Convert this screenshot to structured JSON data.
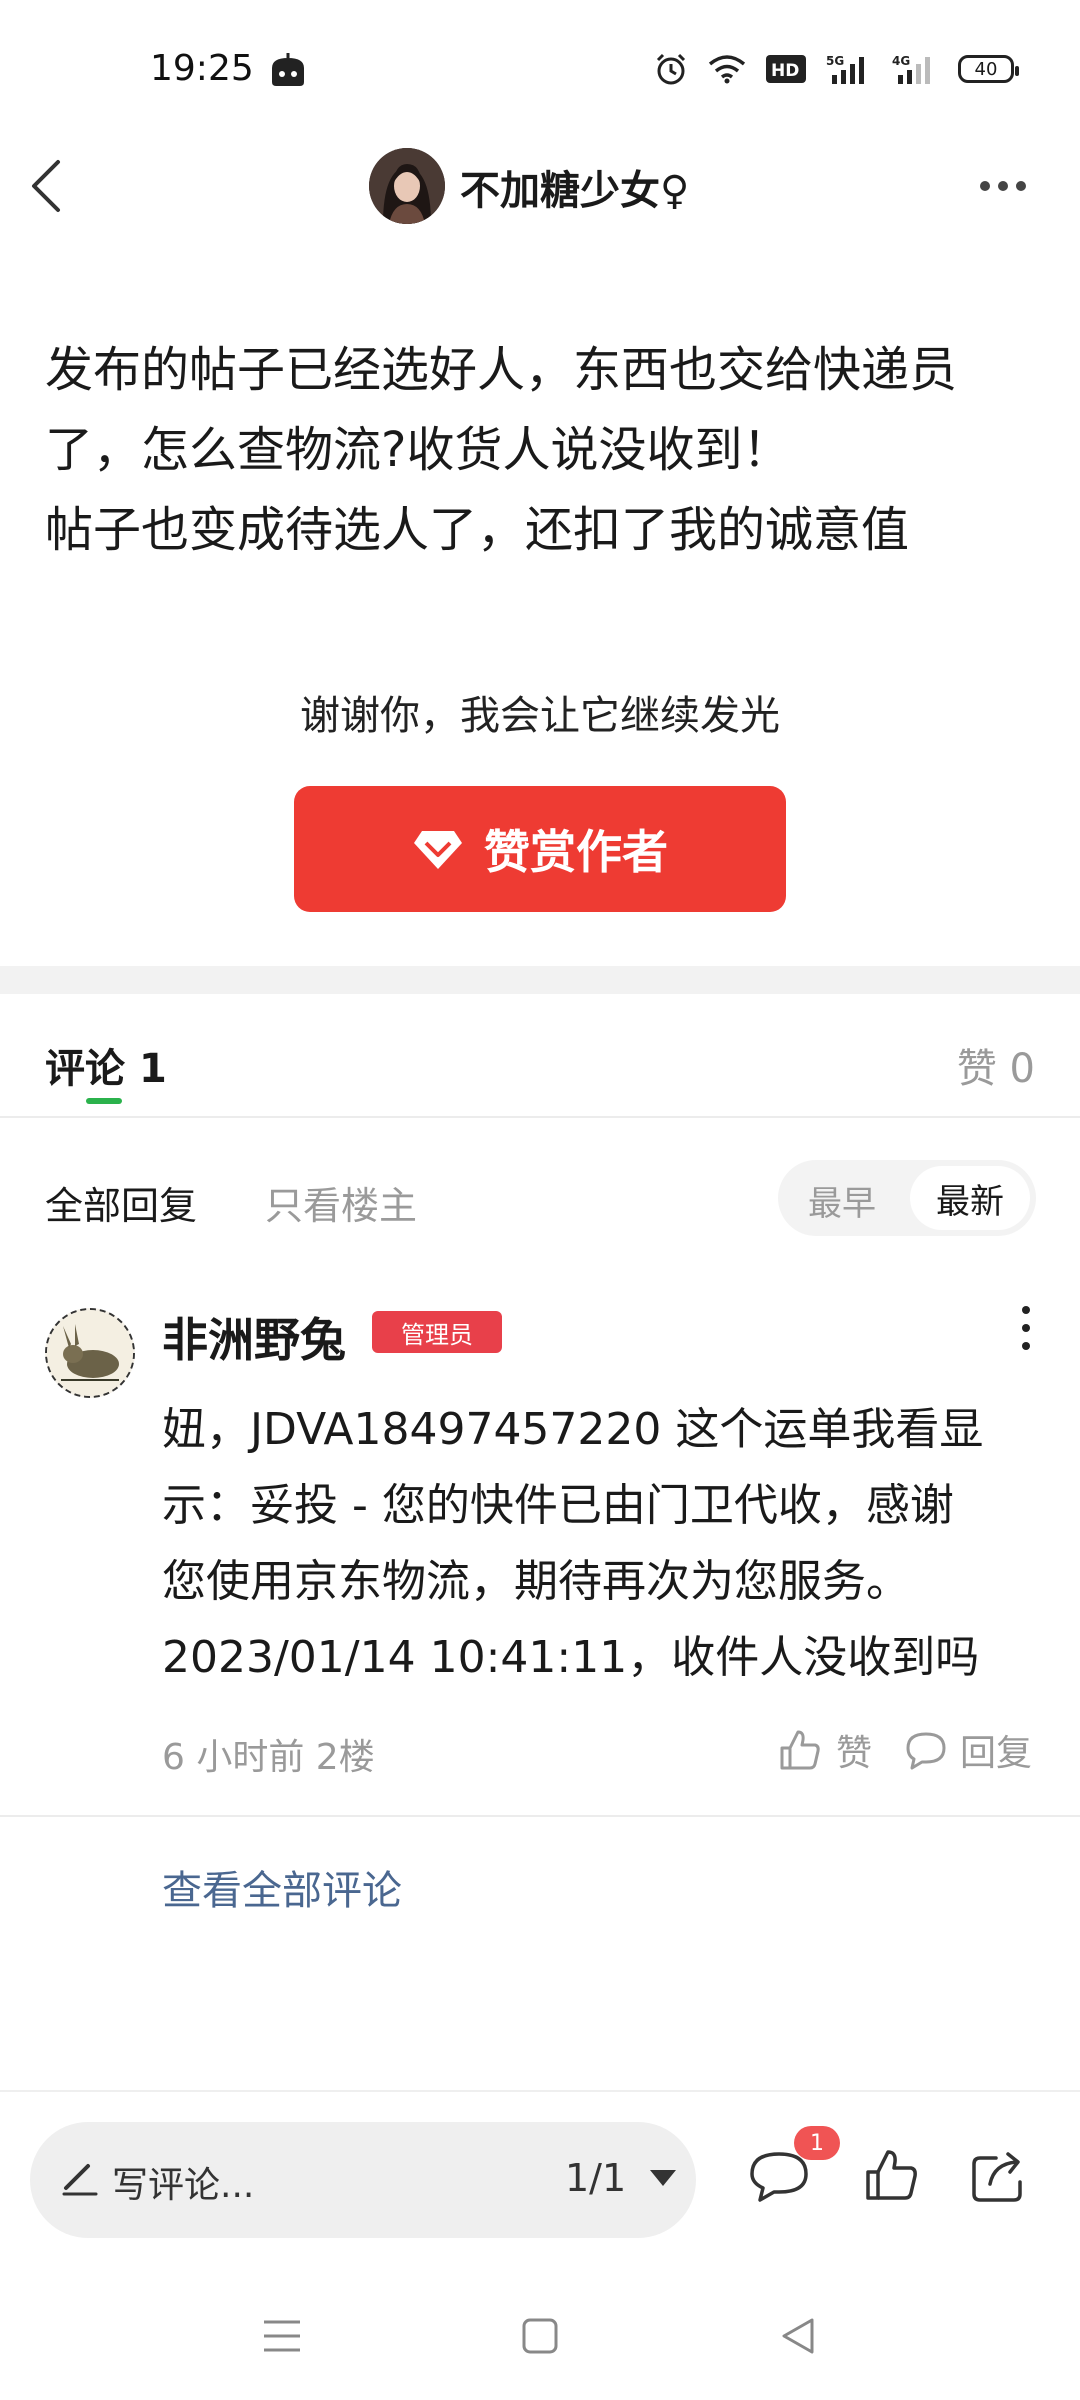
{
  "status_bar": {
    "time": "19:25",
    "battery": "40",
    "icons": [
      "alarm-icon",
      "wifi-icon",
      "hd-icon",
      "5g-signal-icon",
      "4g-signal-icon",
      "battery-icon"
    ]
  },
  "header": {
    "author_name": "不加糖少女♀",
    "back_icon": "chevron-left-icon",
    "more_icon": "more-horizontal-icon"
  },
  "post": {
    "lines": [
      "发布的帖子已经选好人，东西也交给快递员",
      "了，怎么查物流?收货人说没收到！",
      "帖子也变成待选人了，还扣了我的诚意值"
    ],
    "thanks_text": "谢谢你，我会让它继续发光",
    "reward_label": "赞赏作者"
  },
  "tabs": {
    "comments_label": "评论",
    "comments_count": "1",
    "likes_label": "赞 0"
  },
  "filters": {
    "all_replies": "全部回复",
    "owner_only": "只看楼主",
    "sort_earliest": "最早",
    "sort_newest": "最新"
  },
  "comment": {
    "username": "非洲野兔",
    "badge": "管理员",
    "lines": [
      "妞，JDVA18497457220 这个运单我看显",
      "示：妥投 - 您的快件已由门卫代收，感谢",
      "您使用京东物流，期待再次为您服务。",
      "2023/01/14 10:41:11，收件人没收到吗"
    ],
    "meta": "6 小时前  2楼",
    "like_label": "赞",
    "reply_label": "回复"
  },
  "view_all_label": "查看全部评论",
  "bottom_bar": {
    "write_placeholder": "写评论...",
    "page": "1/1",
    "comment_badge": "1"
  },
  "colors": {
    "accent_red": "#ee3b33",
    "tab_underline": "#2bb24c",
    "link": "#4a6790",
    "badge_red": "#e8404a"
  }
}
